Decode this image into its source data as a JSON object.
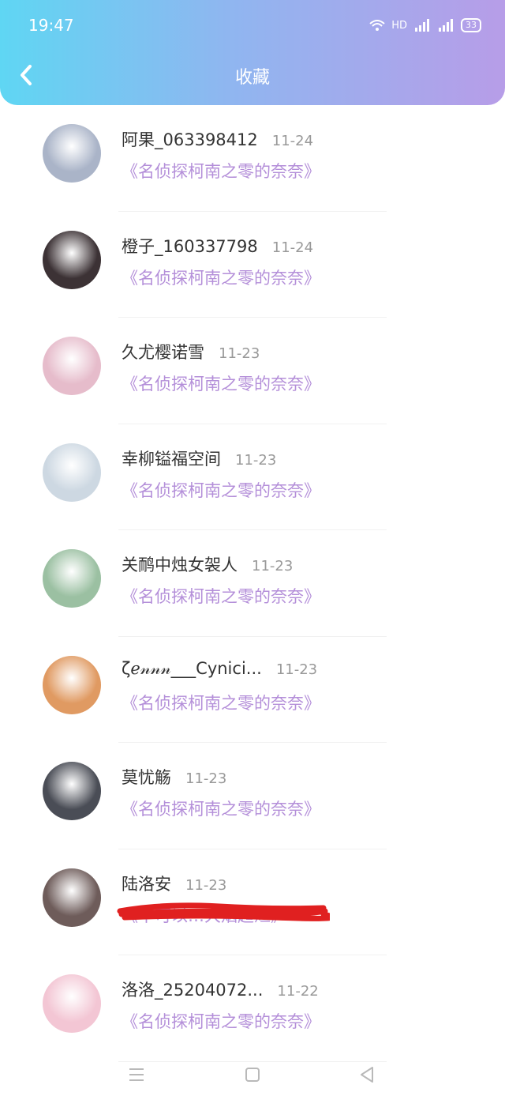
{
  "status": {
    "time": "19:47",
    "network": "HD",
    "battery": "33"
  },
  "header": {
    "title": "收藏"
  },
  "items": [
    {
      "name": "阿果_063398412",
      "date": "11-24",
      "subtitle": "《名侦探柯南之零的奈奈》",
      "avatar_color": "#aab4c8",
      "redacted": false
    },
    {
      "name": "橙子_160337798",
      "date": "11-24",
      "subtitle": "《名侦探柯南之零的奈奈》",
      "avatar_color": "#3c3235",
      "redacted": false
    },
    {
      "name": "久尤樱诺雪",
      "date": "11-23",
      "subtitle": "《名侦探柯南之零的奈奈》",
      "avatar_color": "#e6bccb",
      "redacted": false
    },
    {
      "name": "幸柳镒福空间",
      "date": "11-23",
      "subtitle": "《名侦探柯南之零的奈奈》",
      "avatar_color": "#cdd8e2",
      "redacted": false
    },
    {
      "name": "关鸸中烛女袈人",
      "date": "11-23",
      "subtitle": "《名侦探柯南之零的奈奈》",
      "avatar_color": "#9bc0a2",
      "redacted": false
    },
    {
      "name": "ζℯ𝓃𝓃𝓃___Cynici...",
      "date": "11-23",
      "subtitle": "《名侦探柯南之零的奈奈》",
      "avatar_color": "#e09a62",
      "redacted": false
    },
    {
      "name": "莫忧觞",
      "date": "11-23",
      "subtitle": "《名侦探柯南之零的奈奈》",
      "avatar_color": "#4a4d56",
      "redacted": false
    },
    {
      "name": "陆洛安",
      "date": "11-23",
      "subtitle": "《不可以…大烟超烂》",
      "avatar_color": "#6e5c5a",
      "redacted": true
    },
    {
      "name": "洛洛_25204072...",
      "date": "11-22",
      "subtitle": "《名侦探柯南之零的奈奈》",
      "avatar_color": "#f3c6d4",
      "redacted": false
    }
  ],
  "colors": {
    "accent": "#b48fd9",
    "redaction": "#e02020"
  },
  "nav": [
    "menu-icon",
    "home-icon",
    "back-triangle-icon"
  ]
}
